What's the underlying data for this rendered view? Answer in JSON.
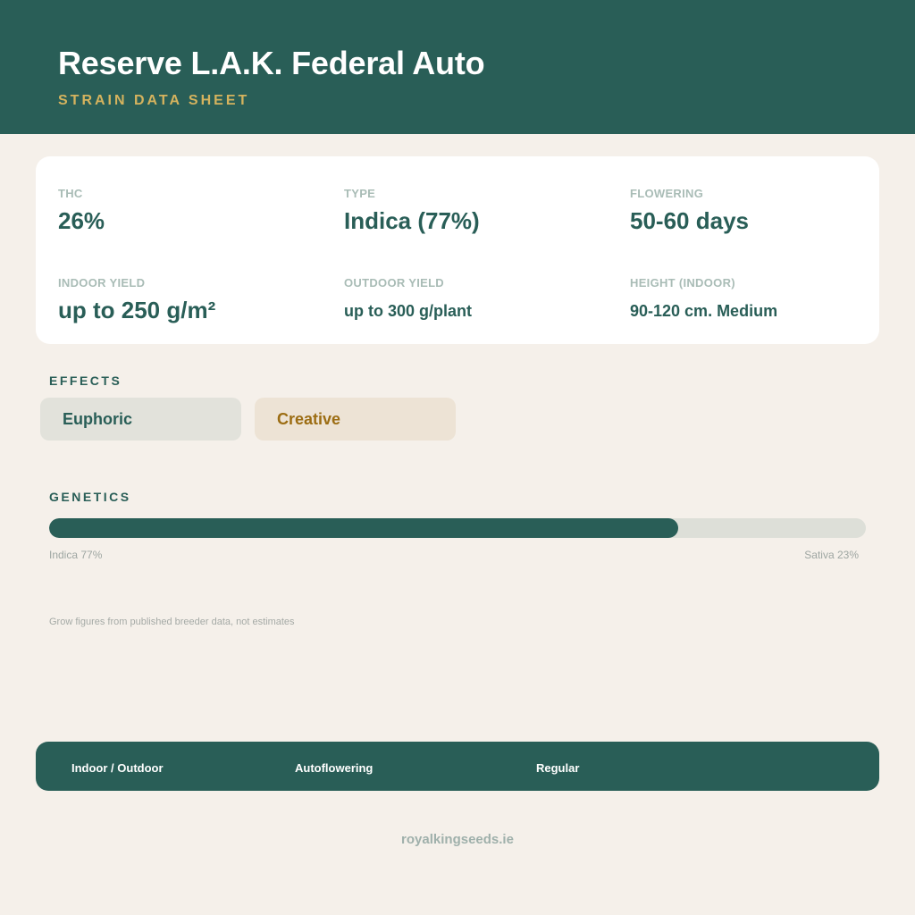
{
  "header": {
    "title": "Reserve L.A.K. Federal Auto",
    "subtitle": "STRAIN DATA SHEET"
  },
  "stats": {
    "thc": {
      "label": "THC",
      "value": "26%"
    },
    "type": {
      "label": "TYPE",
      "value": "Indica (77%)"
    },
    "flowering": {
      "label": "FLOWERING",
      "value": "50-60 days"
    },
    "indoor_yield": {
      "label": "INDOOR YIELD",
      "value": "up to 250 g/m²"
    },
    "outdoor_yield": {
      "label": "OUTDOOR YIELD",
      "value": "up to 300 g/plant"
    },
    "height": {
      "label": "HEIGHT (INDOOR)",
      "value": "90-120 cm. Medium"
    }
  },
  "effects": {
    "label": "EFFECTS",
    "items": [
      "Euphoric",
      "Creative"
    ]
  },
  "genetics": {
    "label": "GENETICS",
    "indica_percent": 77,
    "indica_label": "Indica 77%",
    "sativa_label": "Sativa 23%"
  },
  "note": "Grow figures from published breeder data, not estimates",
  "footer": {
    "tags": [
      "Indoor / Outdoor",
      "Autoflowering",
      "Regular"
    ]
  },
  "site": "royalkingseeds.ie",
  "colors": {
    "primary": "#295e57",
    "accent_gold": "#d5b35e",
    "background": "#f5f0ea"
  }
}
